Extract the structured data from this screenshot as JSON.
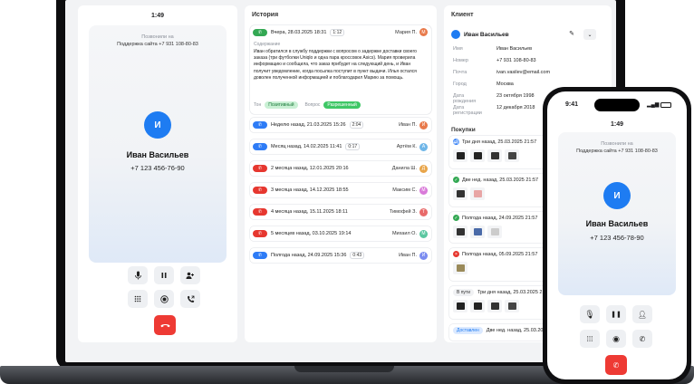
{
  "call": {
    "time": "1:49",
    "calling_label": "Позвонили на",
    "line": "Поддержка сайта +7 931 108-80-83",
    "avatar_letter": "И",
    "name": "Иван Васильев",
    "phone": "+7 123 456-76-90",
    "icons": [
      "microphone-icon",
      "pause-icon",
      "add-user-icon",
      "keypad-icon",
      "record-icon",
      "transfer-call-icon",
      "hang-up-icon"
    ]
  },
  "history": {
    "title": "История",
    "top": {
      "date": "Вчера, 28.03.2025 18:31",
      "duration": "1:12",
      "agent": "Мария П.",
      "content_label": "Содержание",
      "content": "Иван обратился в службу поддержки с вопросом о задержке доставки своего заказа (три футболки Uniqlo и одна пара кроссовок Asics). Мария проверила информацию и сообщила, что заказ прибудет на следующий день, и Иван получит уведомление, когда посылка поступит в пункт выдачи. Илья остался доволен полученной информацией и поблагодарил Марию за помощь.",
      "tone_label": "Тон",
      "tone_value": "Позитивный",
      "question_label": "Вопрос",
      "question_value": "Разрешенный"
    },
    "rows": [
      {
        "type": "in",
        "date": "Неделю назад, 21.03.2025 15:26",
        "duration": "2:04",
        "agent": "Иван П.",
        "initial": "И",
        "color": "#e8794a"
      },
      {
        "type": "in",
        "date": "Месяц назад, 14.02.2025 11:41",
        "duration": "0:17",
        "agent": "Артём К.",
        "initial": "А",
        "color": "#6fb6e8"
      },
      {
        "type": "miss",
        "date": "2 месяца назад, 12.01.2025 20:16",
        "duration": "",
        "agent": "Данила Ш.",
        "initial": "Д",
        "color": "#e8a54a"
      },
      {
        "type": "miss",
        "date": "3 месяца назад, 14.12.2025 18:55",
        "duration": "",
        "agent": "Максим С.",
        "initial": "М",
        "color": "#d97ad9"
      },
      {
        "type": "miss",
        "date": "4 месяца назад, 15.11.2025 18:11",
        "duration": "",
        "agent": "Тимофей З.",
        "initial": "Т",
        "color": "#e86a6a"
      },
      {
        "type": "miss",
        "date": "5 месяцев назад, 03.10.2025 19:14",
        "duration": "",
        "agent": "Михаил О.",
        "initial": "М",
        "color": "#5bc7a0"
      },
      {
        "type": "in",
        "date": "Полгода назад, 24.09.2025 15:36",
        "duration": "0:43",
        "agent": "Иван П.",
        "initial": "И",
        "color": "#7b8cf0"
      }
    ]
  },
  "client": {
    "title": "Клиент",
    "name": "Иван Васильев",
    "fields": [
      {
        "key": "Имя",
        "value": "Иван Васильев"
      },
      {
        "key": "Номер",
        "value": "+7 931 108-80-83"
      },
      {
        "key": "Почта",
        "value": "ivan.vasilev@email.com"
      },
      {
        "key": "Город",
        "value": "Москва"
      },
      {
        "key": "Дата рождения",
        "value": "23 октября 1998"
      },
      {
        "key": "Дата регистрации",
        "value": "12 декабря 2018"
      }
    ],
    "purchases_title": "Покупки",
    "purchases": [
      {
        "status": "truck",
        "head": "Три дня назад, 25.03.2025 21:57",
        "colors": [
          "#222",
          "#222",
          "#333",
          "#444"
        ]
      },
      {
        "status": "done",
        "head": "Две нед. назад, 25.03.2025 21:57",
        "colors": [
          "#333",
          "#e8a5a5"
        ]
      },
      {
        "status": "done",
        "head": "Полгода назад, 24.09.2025 21:57",
        "colors": [
          "#333",
          "#4a6aa8",
          "#ccc"
        ]
      },
      {
        "status": "cancel",
        "head": "Полгода назад, 05.09.2025 21:57",
        "colors": [
          "#9a8a5a"
        ]
      },
      {
        "status": "in_transit",
        "head": "Три дня назад, 25.03.2025 21:57",
        "badge": "В пути",
        "colors": [
          "#222",
          "#222",
          "#333",
          "#444"
        ]
      },
      {
        "status": "delivered",
        "head": "Две нед. назад, 25.03.2025 21:57",
        "badge": "Доставлен",
        "colors": []
      }
    ]
  },
  "phone": {
    "clock": "9:41",
    "time": "1:49",
    "calling_label": "Позвонили на",
    "line": "Поддержка сайта +7 931 108-80-83",
    "avatar_letter": "И",
    "name": "Иван Васильев",
    "phone": "+7 123 456-78-90"
  }
}
